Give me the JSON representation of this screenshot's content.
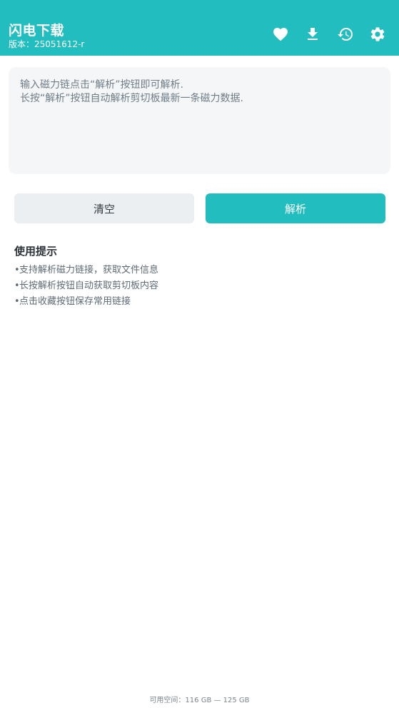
{
  "header": {
    "title": "闪电下载",
    "version": "版本：25051612-r",
    "icons": [
      "heart-icon",
      "download-icon",
      "history-icon",
      "settings-icon"
    ],
    "background_color": "#22bdbf"
  },
  "input": {
    "placeholder": "输入磁力链点击“解析”按钮即可解析.\n长按“解析”按钮自动解析剪切板最新一条磁力数据.",
    "value": ""
  },
  "buttons": {
    "clear_label": "清空",
    "parse_label": "解析"
  },
  "tips": {
    "title": "使用提示",
    "bullet": "•",
    "items": [
      "支持解析磁力链接，获取文件信息",
      "长按解析按钮自动获取剪切板内容",
      "点击收藏按钮保存常用链接"
    ]
  },
  "footer": {
    "storage": "可用空间：116 GB — 125 GB"
  }
}
